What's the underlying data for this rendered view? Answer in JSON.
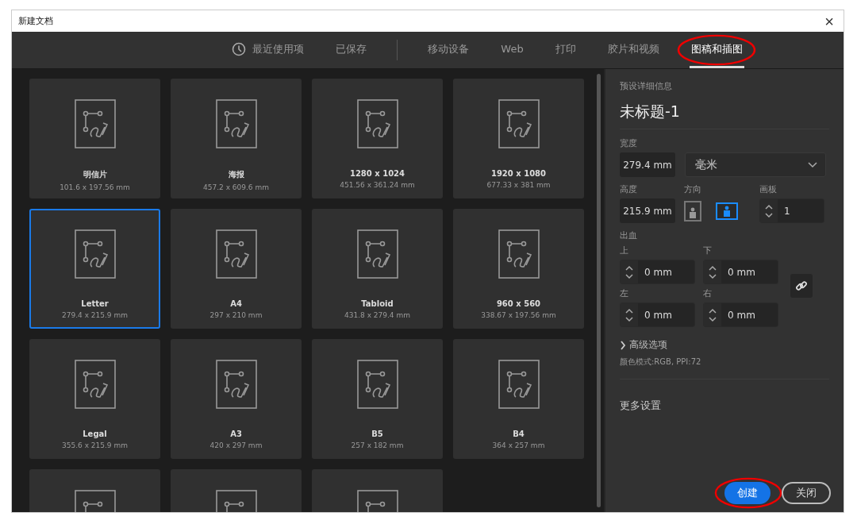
{
  "window": {
    "title": "新建文档",
    "close": "×"
  },
  "tabs": [
    {
      "label": "最近使用项",
      "selected": false,
      "circled": false
    },
    {
      "label": "已保存",
      "selected": false,
      "circled": false
    },
    {
      "label": "移动设备",
      "selected": false,
      "circled": false
    },
    {
      "label": "Web",
      "selected": false,
      "circled": false
    },
    {
      "label": "打印",
      "selected": false,
      "circled": false
    },
    {
      "label": "胶片和视频",
      "selected": false,
      "circled": false
    },
    {
      "label": "图稿和插图",
      "selected": true,
      "circled": true
    }
  ],
  "presets": [
    {
      "name": "明信片",
      "size": "101.6 x 197.56 mm",
      "selected": false
    },
    {
      "name": "海报",
      "size": "457.2 x 609.6 mm",
      "selected": false
    },
    {
      "name": "1280 x 1024",
      "size": "451.56 x 361.24 mm",
      "selected": false
    },
    {
      "name": "1920 x 1080",
      "size": "677.33 x 381 mm",
      "selected": false
    },
    {
      "name": "Letter",
      "size": "279.4 x 215.9 mm",
      "selected": true
    },
    {
      "name": "A4",
      "size": "297 x 210 mm",
      "selected": false
    },
    {
      "name": "Tabloid",
      "size": "431.8 x 279.4 mm",
      "selected": false
    },
    {
      "name": "960 x 560",
      "size": "338.67 x 197.56 mm",
      "selected": false
    },
    {
      "name": "Legal",
      "size": "355.6 x 215.9 mm",
      "selected": false
    },
    {
      "name": "A3",
      "size": "420 x 297 mm",
      "selected": false
    },
    {
      "name": "B5",
      "size": "257 x 182 mm",
      "selected": false
    },
    {
      "name": "B4",
      "size": "364 x 257 mm",
      "selected": false
    },
    {
      "selected": false
    },
    {
      "selected": false
    },
    {
      "selected": false
    }
  ],
  "details": {
    "heading": "预设详细信息",
    "doc_title": "未标题-1",
    "width": {
      "label": "宽度",
      "value": "279.4 mm"
    },
    "unit": "毫米",
    "height": {
      "label": "高度",
      "value": "215.9 mm"
    },
    "orientation": {
      "label": "方向",
      "options": [
        {
          "selected": false
        },
        {
          "selected": true
        }
      ]
    },
    "artboards": {
      "label": "画板",
      "value": "1"
    },
    "bleed": {
      "label": "出血",
      "fields": [
        {
          "label": "上",
          "value": "0 mm"
        },
        {
          "label": "下",
          "value": "0 mm"
        },
        {
          "label": "左",
          "value": "0 mm"
        },
        {
          "label": "右",
          "value": "0 mm"
        }
      ]
    },
    "advanced": "高级选项",
    "color_mode": "颜色模式:RGB, PPI:72",
    "more": "更多设置"
  },
  "buttons": [
    {
      "label": "创建",
      "kind": "primary",
      "circled": true
    },
    {
      "label": "关闭",
      "kind": "secondary",
      "circled": false
    }
  ]
}
